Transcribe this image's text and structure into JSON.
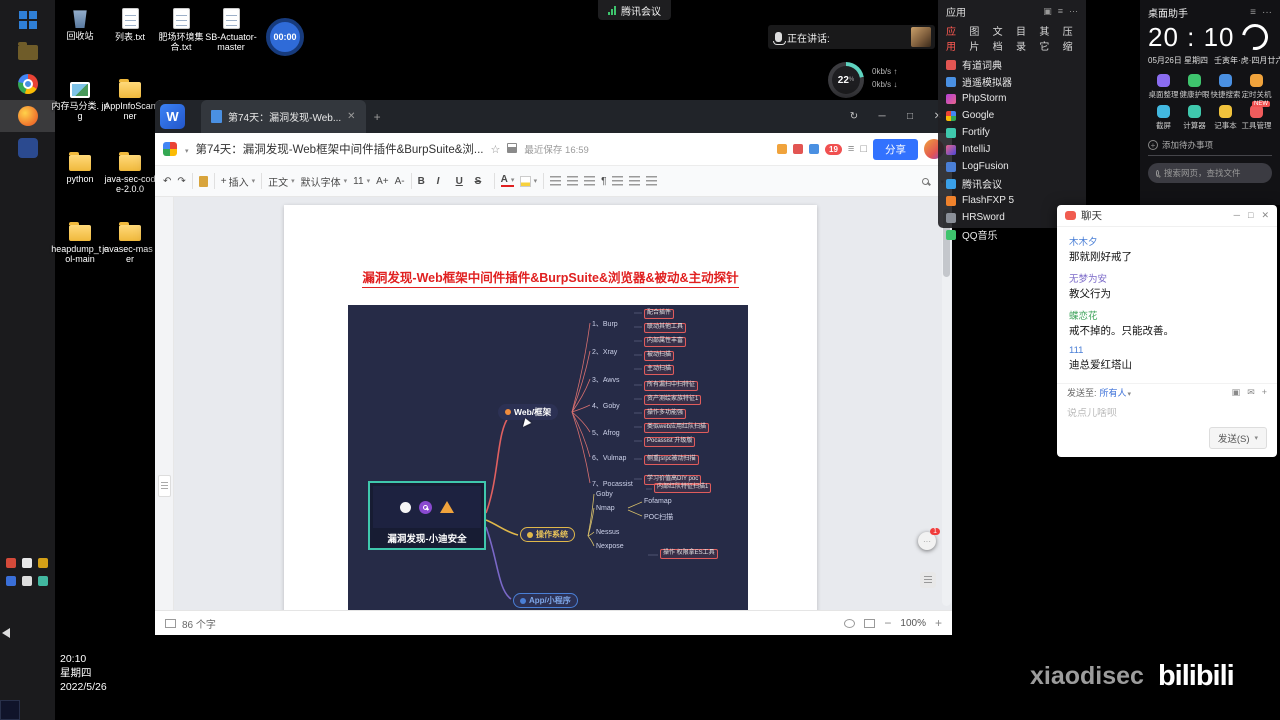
{
  "topbar": {
    "meeting_label": "腾讯会议",
    "rec_timer": "00:00",
    "speaking_label": "正在讲话:",
    "net_percent": "22",
    "net_unit": "%",
    "up_speed": "0kb/s",
    "down_speed": "0kb/s"
  },
  "desktop_icons": [
    {
      "label": "回收站"
    },
    {
      "label": "列表.txt"
    },
    {
      "label": "肥场环境集 合.txt"
    },
    {
      "label": "SB-Actuator- master"
    },
    {
      "label": "内存马分类. jpg"
    },
    {
      "label": "AppInfoScan ner"
    },
    {
      "label": "python"
    },
    {
      "label": "java-sec-cod e-2.0.0"
    },
    {
      "label": "heapdump_t ool-main"
    },
    {
      "label": "javasec-mas ter"
    }
  ],
  "wps": {
    "tab_title": "第74天：漏洞发现-Web...",
    "doc_title": "第74天：漏洞发现-Web框架中间件插件&BurpSuite&浏...",
    "saved_label": "最近保存 16:59",
    "badge_count": "19",
    "share_label": "分享",
    "insert_label": "插入",
    "style_label": "正文",
    "font_label": "默认字体",
    "size_label": "11",
    "grow_label": "A+",
    "shrink_label": "A-",
    "fmt_b": "B",
    "fmt_i": "I",
    "fmt_u": "U",
    "fmt_s": "S",
    "fontcolor_label": "A",
    "sidebar_tab": "目录",
    "status_words": "86 个字",
    "zoom": "100%"
  },
  "document": {
    "heading": "漏洞发现-Web框架中间件插件&BurpSuite&浏览器&被动&主动探针"
  },
  "mindmap": {
    "root": "漏洞发现-小迪安全",
    "center": "Web/框架",
    "tools": [
      "1、Burp",
      "2、Xray",
      "3、Awvs",
      "4、Goby",
      "5、Afrog",
      "6、Vulmap",
      "7、Pocassist"
    ],
    "notes": [
      "配合插件",
      "联动其他工具",
      "内部属性丰富",
      "被动扫描",
      "主动扫描",
      "所有漏扫中扫特征",
      "资产测绘家族特征1",
      "操作多功能强",
      "类似web应用红队扫描",
      "Pocassist 升级版",
      "侧重jsrpc被动扫描",
      "学习价值高DIY poc"
    ],
    "os_node": "操作系统",
    "os_tools": [
      "Goby",
      "Nmap",
      "Fofamap",
      "POC扫描",
      "Nessus",
      "Nexpose"
    ],
    "os_notes": [
      "内部红队特征扫描1",
      "操作 权限拿ES工具"
    ],
    "app_node": "App/小程序"
  },
  "app_panel": {
    "title": "应用",
    "tabs": [
      "应用",
      "图片",
      "文档",
      "目录",
      "其它",
      "压缩"
    ],
    "apps": [
      "有道词典",
      "逍遥模拟器",
      "PhpStorm",
      "Google",
      "Fortify",
      "IntelliJ",
      "LogFusion",
      "腾讯会议",
      "FlashFXP 5",
      "HRSword",
      "QQ音乐"
    ]
  },
  "assistant": {
    "title": "桌面助手",
    "time": "20 : 10",
    "date": "05月26日 星期四",
    "lunar": "壬寅年·虎·四月廿六",
    "shortcuts": [
      "桌面整理",
      "健康护眼",
      "快捷搜索",
      "定时关机",
      "截屏",
      "计算器",
      "记事本",
      "工具管理"
    ],
    "new_badge": "NEW",
    "todo_label": "添加待办事项",
    "search_placeholder": "搜索网页，查找文件"
  },
  "chat": {
    "title": "聊天",
    "messages": [
      {
        "name": "木木夕",
        "text": "那就刚好戒了"
      },
      {
        "name": "无梦为安",
        "text": "教父行为"
      },
      {
        "name": "蝶恋花",
        "text": "戒不掉的。只能改善。"
      },
      {
        "name": "111",
        "text": "迪总爱红塔山"
      }
    ],
    "send_to_label": "发送至:",
    "send_to_value": "所有人",
    "input_placeholder": "说点儿啥呗",
    "send_button": "发送(S)"
  },
  "floating": {
    "badge": "1"
  },
  "tray_clock": {
    "time": "20:10",
    "weekday": "星期四",
    "date": "2022/5/26"
  },
  "watermark": {
    "name": "xiaodisec",
    "brand": "bilibili"
  },
  "colors": {
    "accent": "#3272fe",
    "heading_red": "#e02020",
    "note_red": "#e05c5c",
    "mindmap_bg": "#262b47"
  }
}
